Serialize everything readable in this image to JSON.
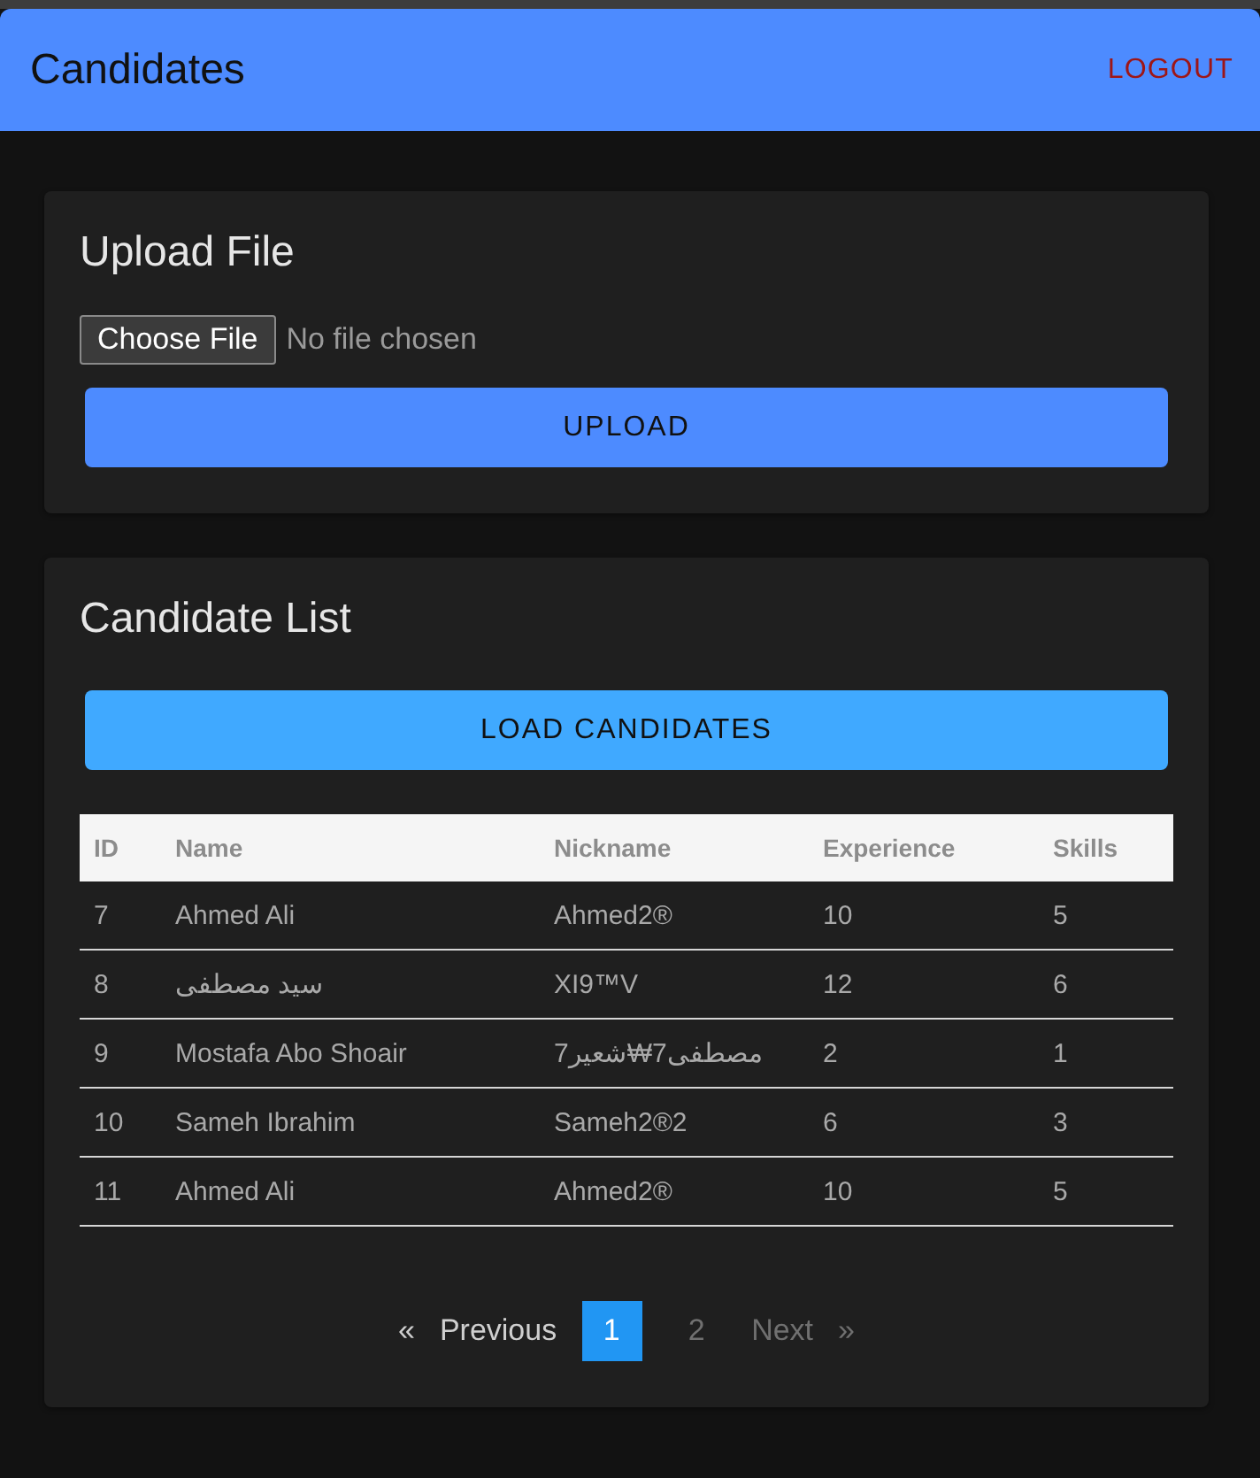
{
  "header": {
    "title": "Candidates",
    "logout": "LOGOUT"
  },
  "upload_card": {
    "title": "Upload File",
    "file_input": {
      "button": "Choose File",
      "status": "No file chosen"
    },
    "upload_button": "UPLOAD"
  },
  "candidate_card": {
    "title": "Candidate List",
    "load_button": "LOAD CANDIDATES",
    "table": {
      "columns": [
        "ID",
        "Name",
        "Nickname",
        "Experience",
        "Skills"
      ],
      "rows": [
        [
          "7",
          "Ahmed Ali",
          "Ahmed2®",
          "10",
          "5"
        ],
        [
          "8",
          "سيد مصطفى",
          "XI9™V",
          "12",
          "6"
        ],
        [
          "9",
          "Mostafa Abo Shoair",
          "مصطفى7₩شعير7",
          "2",
          "1"
        ],
        [
          "10",
          "Sameh Ibrahim",
          "Sameh2®2",
          "6",
          "3"
        ],
        [
          "11",
          "Ahmed Ali",
          "Ahmed2®",
          "10",
          "5"
        ]
      ]
    },
    "pagination": {
      "previous": {
        "arrow": "«",
        "label": "Previous",
        "disabled": true
      },
      "pages": [
        {
          "label": "1",
          "selected": true
        },
        {
          "label": "2",
          "selected": false
        }
      ],
      "next": {
        "arrow": "»",
        "label": "Next",
        "disabled": false
      }
    }
  }
}
